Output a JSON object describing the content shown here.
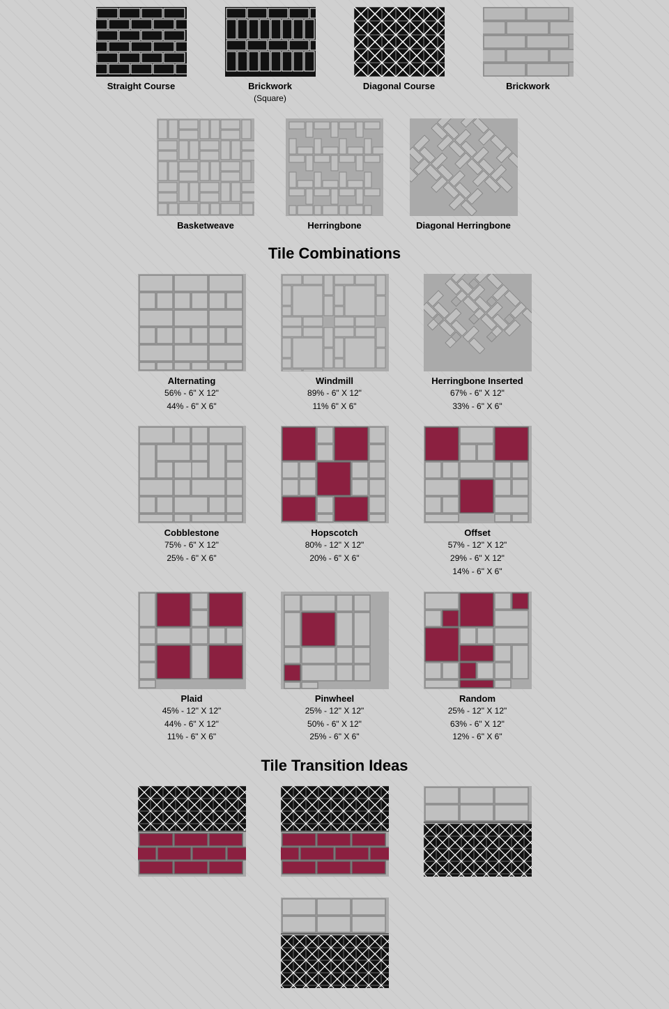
{
  "section1": {
    "patterns": [
      {
        "id": "straight-course",
        "label": "Straight Course",
        "sublabel": "",
        "type": "straight-course"
      },
      {
        "id": "brickwork-square",
        "label": "Brickwork",
        "sublabel2": "(Square)",
        "type": "brickwork-square"
      },
      {
        "id": "diagonal-course",
        "label": "Diagonal Course",
        "sublabel": "",
        "type": "diagonal-course"
      },
      {
        "id": "brickwork",
        "label": "Brickwork",
        "sublabel": "",
        "type": "brickwork"
      }
    ]
  },
  "section2": {
    "patterns": [
      {
        "id": "basketweave",
        "label": "Basketweave",
        "type": "basketweave"
      },
      {
        "id": "herringbone",
        "label": "Herringbone",
        "type": "herringbone"
      },
      {
        "id": "diagonal-herringbone",
        "label": "Diagonal Herringbone",
        "type": "diagonal-herringbone"
      }
    ]
  },
  "tile_combinations_title": "Tile Combinations",
  "section3": {
    "patterns": [
      {
        "id": "alternating",
        "label": "Alternating",
        "lines": [
          "56% - 6\" X 12\"",
          "44% - 6\" X 6\""
        ],
        "type": "alternating"
      },
      {
        "id": "windmill",
        "label": "Windmill",
        "lines": [
          "89% - 6\" X 12\"",
          "11% 6\" X 6\""
        ],
        "type": "windmill"
      },
      {
        "id": "herringbone-inserted",
        "label": "Herringbone Inserted",
        "lines": [
          "67% - 6\" X 12\"",
          "33% - 6\" X 6\""
        ],
        "type": "herringbone-inserted"
      }
    ]
  },
  "section4": {
    "patterns": [
      {
        "id": "cobblestone",
        "label": "Cobblestone",
        "lines": [
          "75% - 6\" X 12\"",
          "25% - 6\" X 6\""
        ],
        "type": "cobblestone"
      },
      {
        "id": "hopscotch",
        "label": "Hopscotch",
        "lines": [
          "80% - 12\" X 12\"",
          "20% - 6\" X 6\""
        ],
        "type": "hopscotch"
      },
      {
        "id": "offset",
        "label": "Offset",
        "lines": [
          "57% - 12\" X 12\"",
          "29% - 6\" X 12\"",
          "14% - 6\" X 6\""
        ],
        "type": "offset"
      }
    ]
  },
  "section5": {
    "patterns": [
      {
        "id": "plaid",
        "label": "Plaid",
        "lines": [
          "45% - 12\" X 12\"",
          "44% - 6\" X 12\"",
          "11% - 6\" X 6\""
        ],
        "type": "plaid"
      },
      {
        "id": "pinwheel",
        "label": "Pinwheel",
        "lines": [
          "25% - 12\" X 12\"",
          "50% - 6\" X 12\"",
          "25% - 6\" X 6\""
        ],
        "type": "pinwheel"
      },
      {
        "id": "random",
        "label": "Random",
        "lines": [
          "25% - 12\" X 12\"",
          "63% - 6\" X 12\"",
          "12% - 6\" X 6\""
        ],
        "type": "random"
      }
    ]
  },
  "tile_transitions_title": "Tile Transition Ideas",
  "colors": {
    "dark": "#1a1a1a",
    "gray_light": "#b0b0b0",
    "gray_mid": "#909090",
    "gray_dark": "#707070",
    "burgundy": "#8b2040",
    "white": "#ffffff",
    "tile_bg": "#c0c0c0",
    "tile_border": "#888888"
  }
}
